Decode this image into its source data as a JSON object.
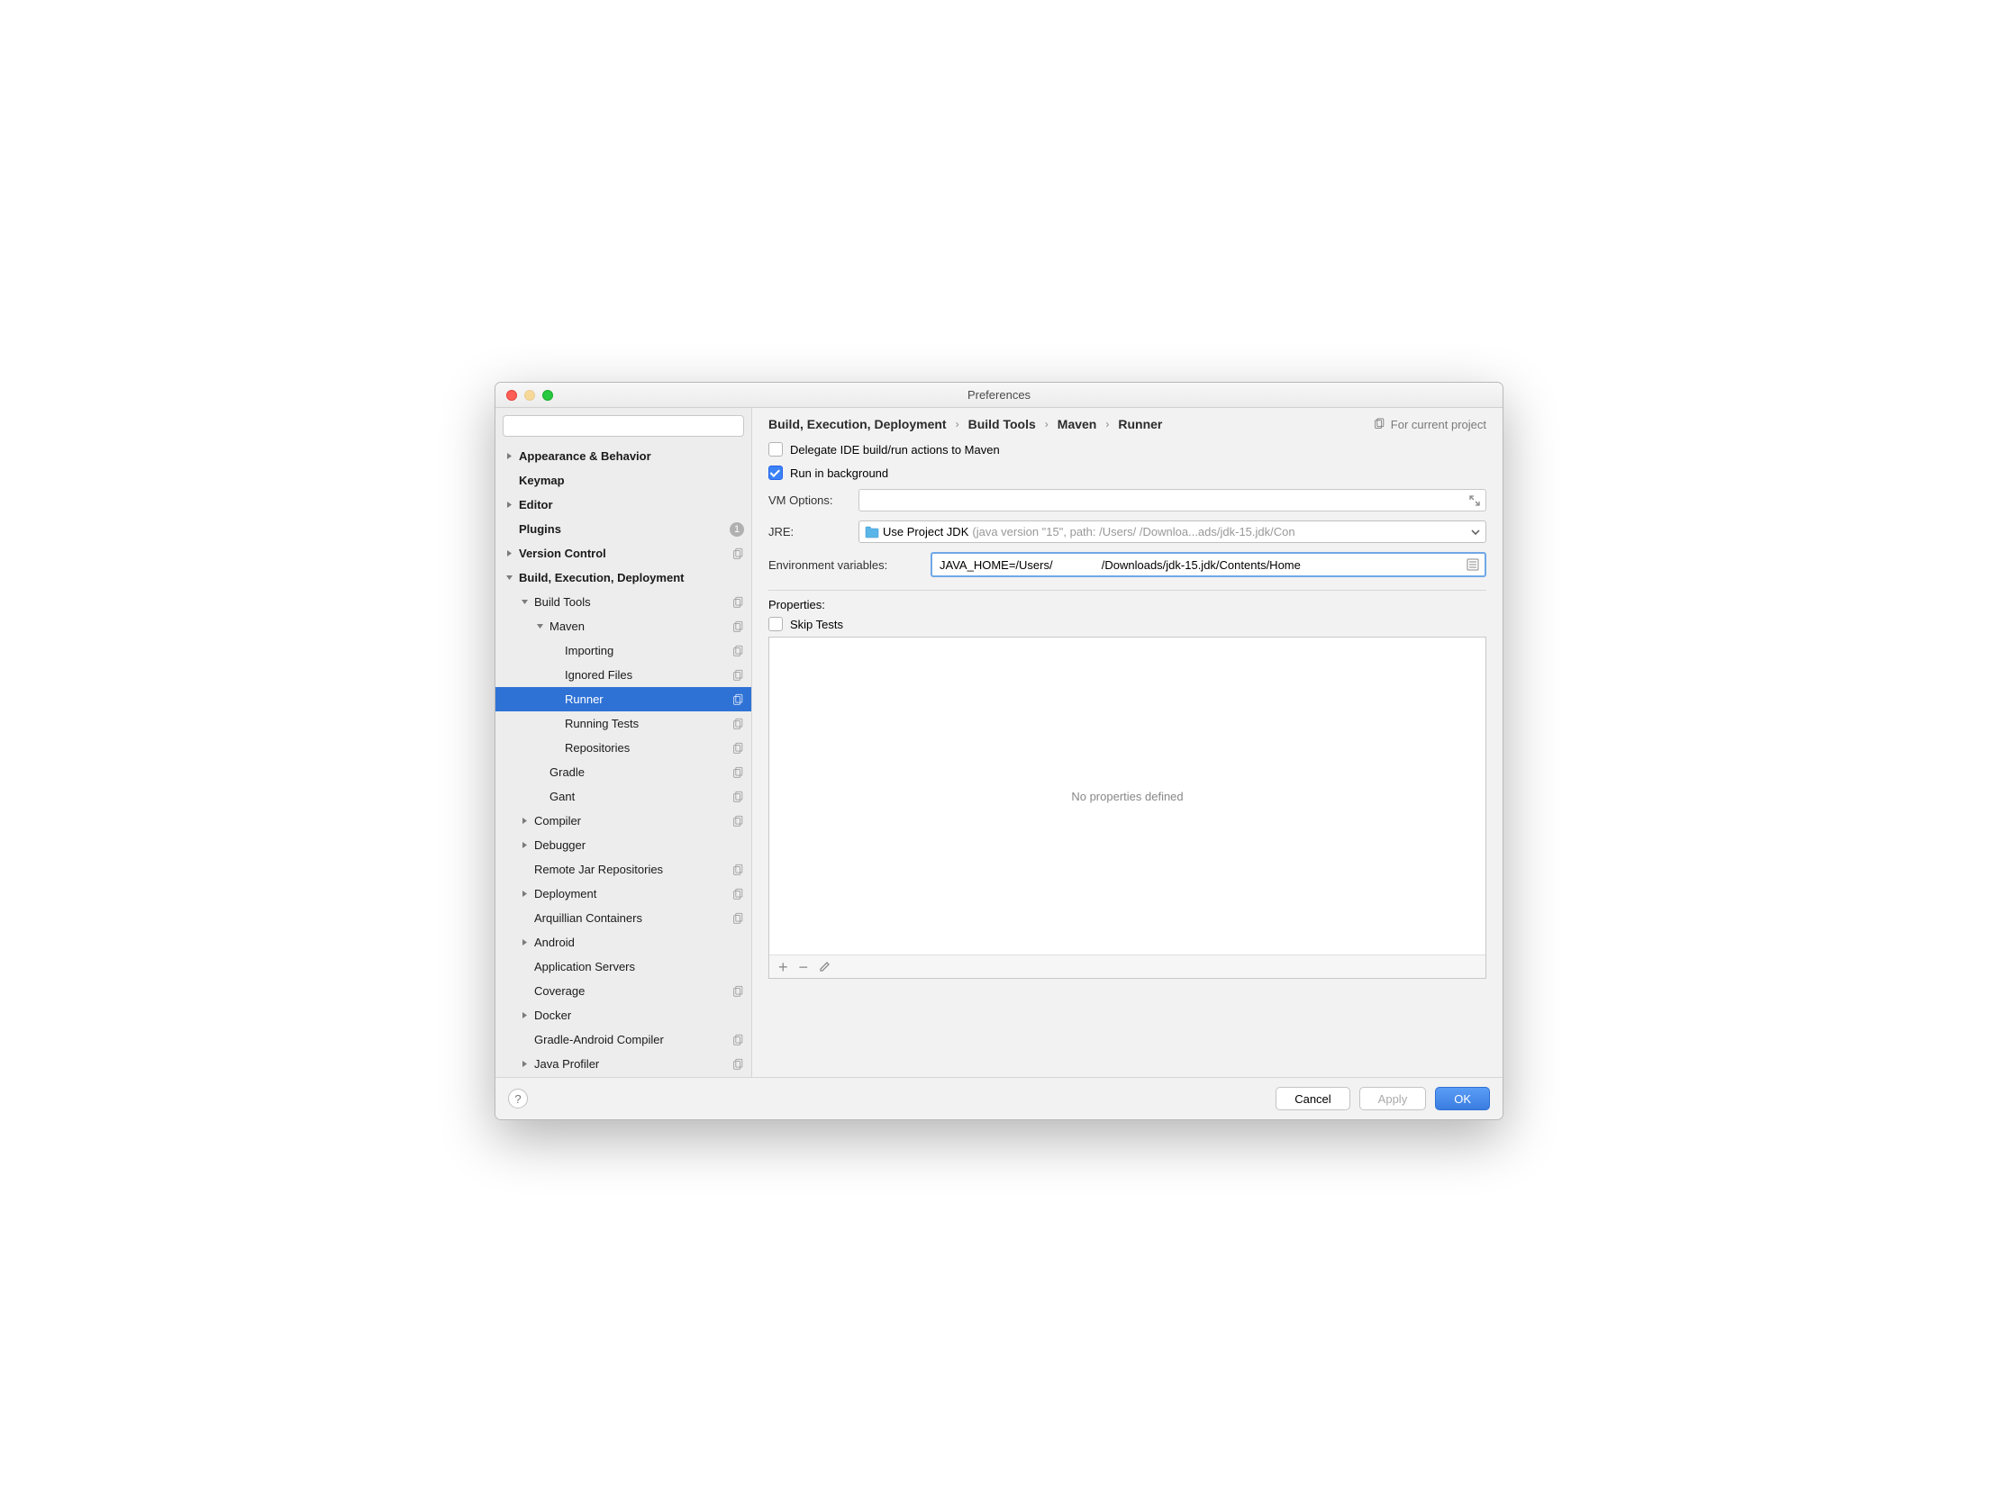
{
  "window": {
    "title": "Preferences"
  },
  "search": {
    "placeholder": ""
  },
  "sidebar": {
    "items": [
      {
        "label": "Appearance & Behavior",
        "indent": 0,
        "arrow": "right",
        "bold": true
      },
      {
        "label": "Keymap",
        "indent": 0,
        "bold": true
      },
      {
        "label": "Editor",
        "indent": 0,
        "arrow": "right",
        "bold": true
      },
      {
        "label": "Plugins",
        "indent": 0,
        "bold": true,
        "badge": "1"
      },
      {
        "label": "Version Control",
        "indent": 0,
        "arrow": "right",
        "bold": true,
        "copy": true
      },
      {
        "label": "Build, Execution, Deployment",
        "indent": 0,
        "arrow": "down",
        "bold": true
      },
      {
        "label": "Build Tools",
        "indent": 1,
        "arrow": "down",
        "copy": true
      },
      {
        "label": "Maven",
        "indent": 2,
        "arrow": "down",
        "copy": true
      },
      {
        "label": "Importing",
        "indent": 3,
        "copy": true
      },
      {
        "label": "Ignored Files",
        "indent": 3,
        "copy": true
      },
      {
        "label": "Runner",
        "indent": 3,
        "copy": true,
        "selected": true
      },
      {
        "label": "Running Tests",
        "indent": 3,
        "copy": true
      },
      {
        "label": "Repositories",
        "indent": 3,
        "copy": true
      },
      {
        "label": "Gradle",
        "indent": 2,
        "copy": true
      },
      {
        "label": "Gant",
        "indent": 2,
        "copy": true
      },
      {
        "label": "Compiler",
        "indent": 1,
        "arrow": "right",
        "copy": true
      },
      {
        "label": "Debugger",
        "indent": 1,
        "arrow": "right"
      },
      {
        "label": "Remote Jar Repositories",
        "indent": 1,
        "copy": true
      },
      {
        "label": "Deployment",
        "indent": 1,
        "arrow": "right",
        "copy": true
      },
      {
        "label": "Arquillian Containers",
        "indent": 1,
        "copy": true
      },
      {
        "label": "Android",
        "indent": 1,
        "arrow": "right"
      },
      {
        "label": "Application Servers",
        "indent": 1
      },
      {
        "label": "Coverage",
        "indent": 1,
        "copy": true
      },
      {
        "label": "Docker",
        "indent": 1,
        "arrow": "right"
      },
      {
        "label": "Gradle-Android Compiler",
        "indent": 1,
        "copy": true
      },
      {
        "label": "Java Profiler",
        "indent": 1,
        "arrow": "right",
        "copy": true
      }
    ]
  },
  "breadcrumb": {
    "parts": [
      "Build, Execution, Deployment",
      "Build Tools",
      "Maven",
      "Runner"
    ],
    "project_hint": "For current project"
  },
  "form": {
    "delegate": {
      "label": "Delegate IDE build/run actions to Maven",
      "checked": false
    },
    "background": {
      "label": "Run in background",
      "checked": true
    },
    "vm_label": "VM Options:",
    "vm_value": "",
    "jre_label": "JRE:",
    "jre_value": "Use Project JDK",
    "jre_hint": "(java version \"15\", path: /Users/            /Downloa...ads/jdk-15.jdk/Con",
    "env_label": "Environment variables:",
    "env_value": "JAVA_HOME=/Users/               /Downloads/jdk-15.jdk/Contents/Home",
    "properties_label": "Properties:",
    "skip_tests": {
      "label": "Skip Tests",
      "checked": false
    },
    "properties_empty": "No properties defined"
  },
  "footer": {
    "cancel": "Cancel",
    "apply": "Apply",
    "ok": "OK"
  }
}
